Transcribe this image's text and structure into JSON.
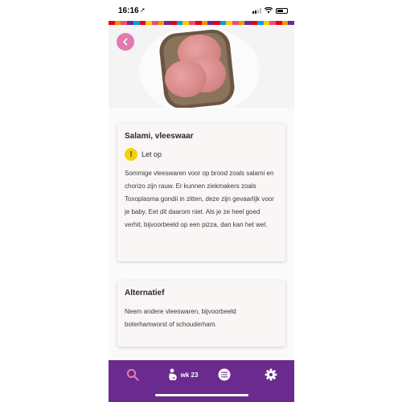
{
  "status_bar": {
    "time": "16:16",
    "location_glyph": "➚"
  },
  "stripe_colors": [
    "#e2001a",
    "#f39200",
    "#e94e77",
    "#6a2a8e",
    "#00a0e1",
    "#e2001a",
    "#ffcc00",
    "#e94e77",
    "#f39200",
    "#6a2a8e",
    "#e2001a",
    "#00a0e1",
    "#ffcc00",
    "#e94e77",
    "#e2001a",
    "#f39200",
    "#6a2a8e",
    "#e2001a",
    "#00a0e1",
    "#ffcc00",
    "#e94e77",
    "#f39200",
    "#6a2a8e",
    "#e2001a",
    "#00a0e1",
    "#ffcc00",
    "#e94e77",
    "#e2001a",
    "#f39200",
    "#6a2a8e"
  ],
  "hero": {
    "image": "salami-on-bread-photo"
  },
  "back_button": {
    "icon": "chevron-left-icon",
    "color": "#e27ab2"
  },
  "product_card": {
    "title": "Salami, vleeswaar",
    "warning_glyph": "!",
    "warning_label": "Let op",
    "warning_color": "#f4d20a",
    "body": "Sommige vleeswaren voor op brood zoals salami en chorizo zijn rauw. Er kunnen ziekmakers zoals Toxoplasma gondii in zitten, deze zijn gevaarlijk voor je baby. Eet dit daarom niet. Als je ze heel goed verhit, bijvoorbeeld op een pizza, dan kan het wel."
  },
  "alternative_card": {
    "title": "Alternatief",
    "body": "Neem andere vleeswaren, bijvoorbeeld boterhamworst of schouderham."
  },
  "tab_bar": {
    "background": "#6a2a8e",
    "accent": "#e27ab2",
    "items": [
      {
        "icon": "search-icon",
        "active": true
      },
      {
        "icon": "pregnancy-icon",
        "label": "wk 23"
      },
      {
        "icon": "list-icon"
      },
      {
        "icon": "gear-icon"
      }
    ]
  }
}
